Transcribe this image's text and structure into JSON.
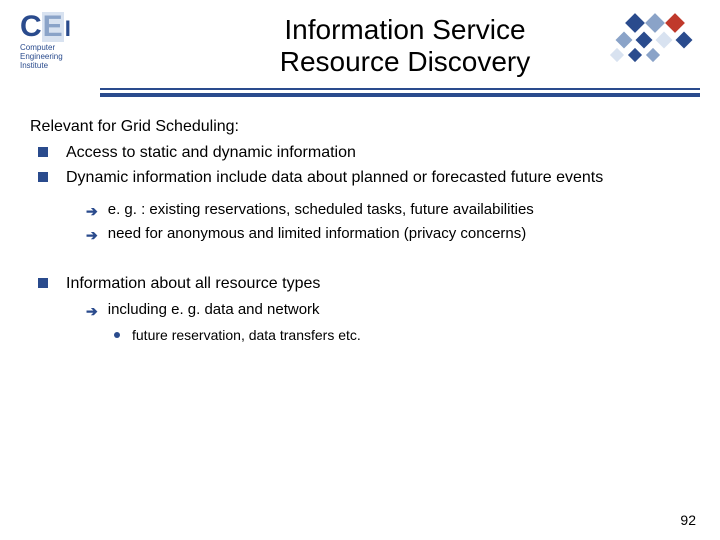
{
  "logo": {
    "c": "C",
    "e": "E",
    "i": "I",
    "sub1": "Computer",
    "sub2": "Engineering",
    "sub3": "Institute"
  },
  "title_line1": "Information Service",
  "title_line2": "Resource Discovery",
  "lead": "Relevant for Grid Scheduling:",
  "b1": "Access to static and dynamic information",
  "b2": "Dynamic information include data about planned or forecasted future events",
  "b2_sub1": "e. g. : existing reservations, scheduled tasks, future availabilities",
  "b2_sub2": "need for anonymous and limited information (privacy concerns)",
  "b3": "Information about all resource types",
  "b3_sub1": "including e. g. data and network",
  "b3_sub1_sub1": "future reservation, data transfers etc.",
  "page_number": "92",
  "colors": {
    "primary": "#2a4b8d",
    "accent_red": "#c0392b"
  }
}
